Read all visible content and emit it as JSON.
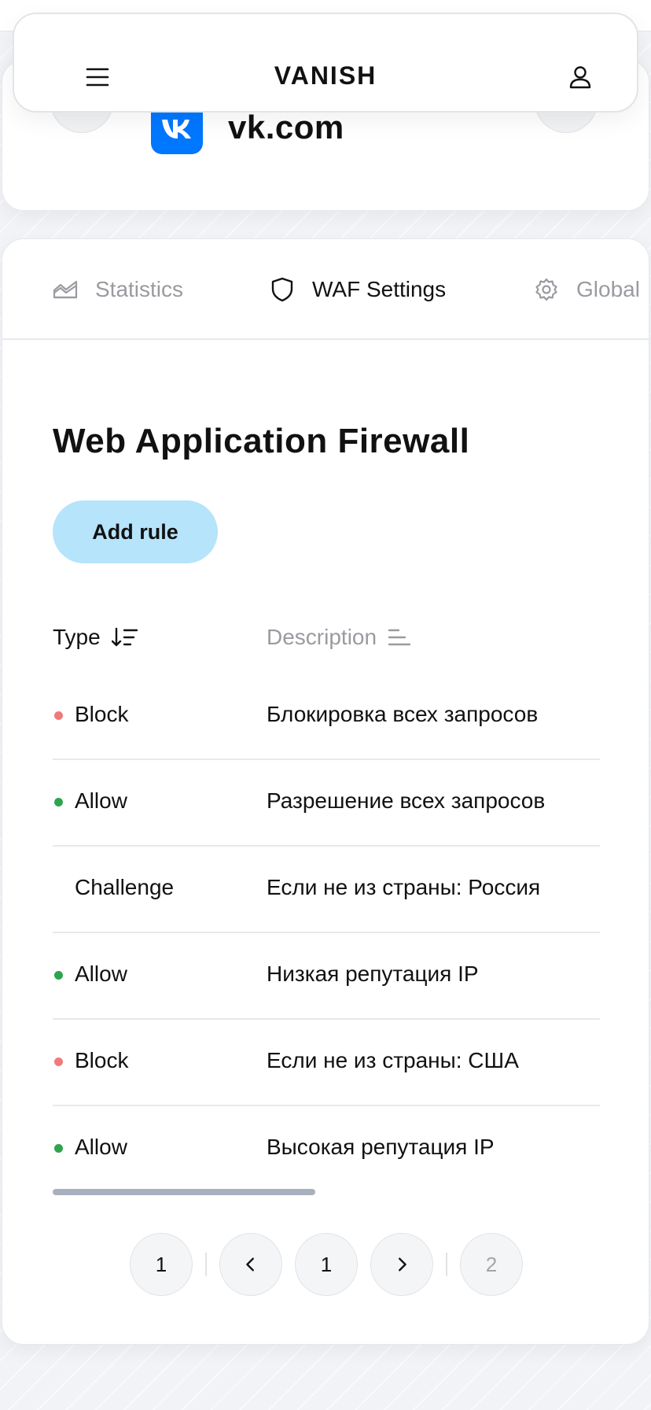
{
  "header": {
    "brand": "VANISH"
  },
  "domain": {
    "name": "vk.com"
  },
  "tabs": [
    {
      "label": "Statistics",
      "icon": "chart-area-icon",
      "active": false
    },
    {
      "label": "WAF Settings",
      "icon": "shield-icon",
      "active": true
    },
    {
      "label": "Global",
      "icon": "gear-icon",
      "active": false
    }
  ],
  "page": {
    "title": "Web Application Firewall",
    "add_rule_label": "Add rule"
  },
  "table": {
    "columns": [
      {
        "label": "Type",
        "sort_icon": "sort-descending-icon"
      },
      {
        "label": "Description",
        "sort_icon": "sort-lines-icon"
      }
    ],
    "rows": [
      {
        "type": "Block",
        "description": "Блокировка всех запросов",
        "status": "block"
      },
      {
        "type": "Allow",
        "description": "Разрешение всех запросов",
        "status": "allow"
      },
      {
        "type": "Challenge",
        "description": "Если не из страны: Россия",
        "status": "challenge"
      },
      {
        "type": "Allow",
        "description": "Низкая репутация IP",
        "status": "allow"
      },
      {
        "type": "Block",
        "description": "Если не из страны: США",
        "status": "block"
      },
      {
        "type": "Allow",
        "description": "Высокая репутация IP",
        "status": "allow"
      }
    ]
  },
  "pagination": {
    "first": "1",
    "current": "1",
    "last": "2"
  },
  "colors": {
    "accent": "#b5e4fb",
    "block_dot": "#f07a7a",
    "allow_dot": "#2da44e",
    "vk_blue": "#0077ff",
    "close_red": "#f07a7a"
  }
}
